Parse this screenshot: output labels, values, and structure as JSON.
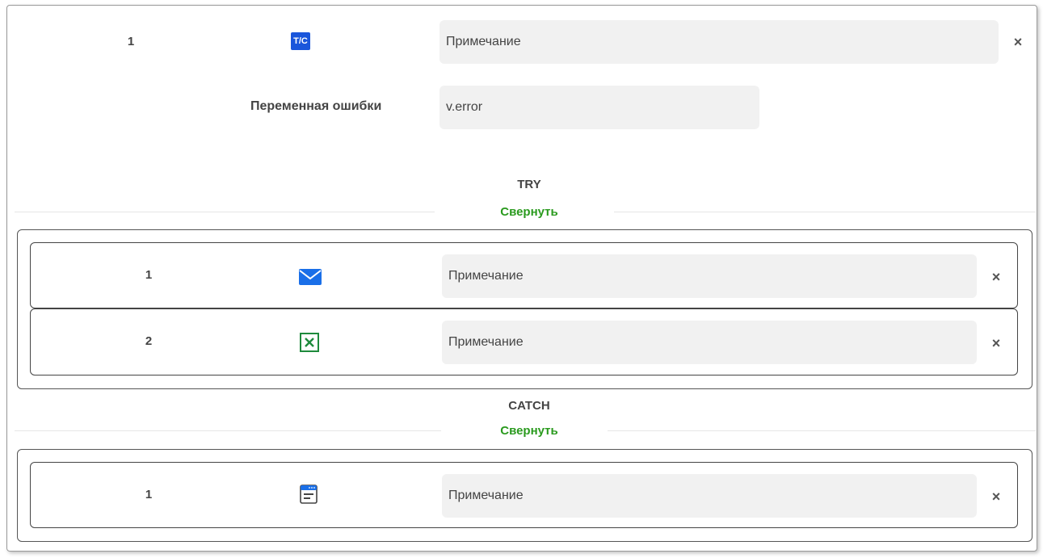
{
  "main_step": {
    "number": "1",
    "icon_text": "T/C",
    "icon": "try-catch-icon",
    "note_placeholder": "Примечание",
    "close": "×",
    "error_var_label": "Переменная ошибки",
    "error_var_value": "v.error"
  },
  "try_section": {
    "title": "TRY",
    "collapse_label": "Свернуть",
    "steps": [
      {
        "number": "1",
        "icon": "mail-icon",
        "note_placeholder": "Примечание",
        "close": "×"
      },
      {
        "number": "2",
        "icon": "excel-icon",
        "note_placeholder": "Примечание",
        "close": "×"
      }
    ]
  },
  "catch_section": {
    "title": "CATCH",
    "collapse_label": "Свернуть",
    "steps": [
      {
        "number": "1",
        "icon": "window-icon",
        "note_placeholder": "Примечание",
        "close": "×"
      }
    ]
  },
  "colors": {
    "accent_green": "#2a9a1e",
    "tc_icon_blue": "#1a56db",
    "mail_icon_blue": "#1a6fe8",
    "excel_icon_green": "#1e8a3c"
  }
}
